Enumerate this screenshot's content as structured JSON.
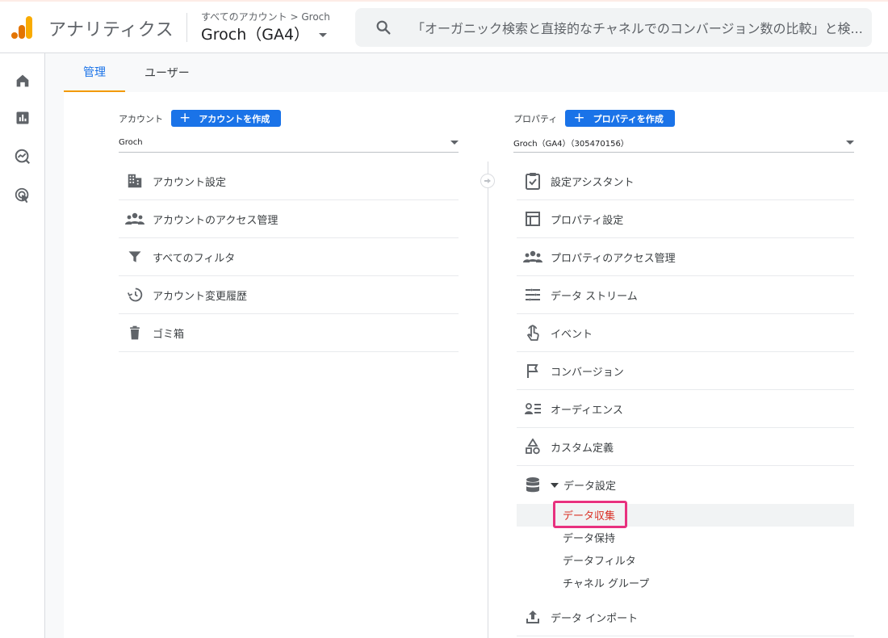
{
  "header": {
    "app_title": "アナリティクス",
    "breadcrumb": "すべてのアカウント > Groch",
    "property_name": "Groch（GA4）",
    "search_placeholder": "「オーガニック検索と直接的なチャネルでのコンバージョン数の比較」と検..."
  },
  "leftnav": {
    "items": [
      {
        "icon": "home-icon"
      },
      {
        "icon": "reports-icon"
      },
      {
        "icon": "explore-icon"
      },
      {
        "icon": "advertising-icon"
      }
    ]
  },
  "tabs": [
    {
      "label": "管理",
      "active": true
    },
    {
      "label": "ユーザー",
      "active": false
    }
  ],
  "account": {
    "header_label": "アカウント",
    "create_button": "アカウントを作成",
    "selected": "Groch",
    "items": [
      {
        "label": "アカウント設定",
        "icon": "building-icon"
      },
      {
        "label": "アカウントのアクセス管理",
        "icon": "people-icon"
      },
      {
        "label": "すべてのフィルタ",
        "icon": "filter-icon"
      },
      {
        "label": "アカウント変更履歴",
        "icon": "history-icon"
      },
      {
        "label": "ゴミ箱",
        "icon": "trash-icon"
      }
    ]
  },
  "property": {
    "header_label": "プロパティ",
    "create_button": "プロパティを作成",
    "selected": "Groch（GA4）（305470156）",
    "items": [
      {
        "label": "設定アシスタント",
        "icon": "checklist-icon"
      },
      {
        "label": "プロパティ設定",
        "icon": "layout-icon"
      },
      {
        "label": "プロパティのアクセス管理",
        "icon": "people-icon"
      },
      {
        "label": "データ ストリーム",
        "icon": "streams-icon"
      },
      {
        "label": "イベント",
        "icon": "touch-icon"
      },
      {
        "label": "コンバージョン",
        "icon": "flag-icon"
      },
      {
        "label": "オーディエンス",
        "icon": "audience-icon"
      },
      {
        "label": "カスタム定義",
        "icon": "shapes-icon"
      }
    ],
    "data_settings": {
      "label": "データ設定",
      "icon": "database-icon",
      "sub_items": [
        "データ収集",
        "データ保持",
        "データフィルタ",
        "チャネル グループ"
      ],
      "selected_index": 0
    },
    "data_import": {
      "label": "データ インポート",
      "icon": "upload-icon"
    }
  },
  "colors": {
    "accent_blue": "#1a73e8",
    "tab_underline": "#f29900",
    "highlight_border": "#e8317f",
    "selected_text": "#d93025"
  }
}
